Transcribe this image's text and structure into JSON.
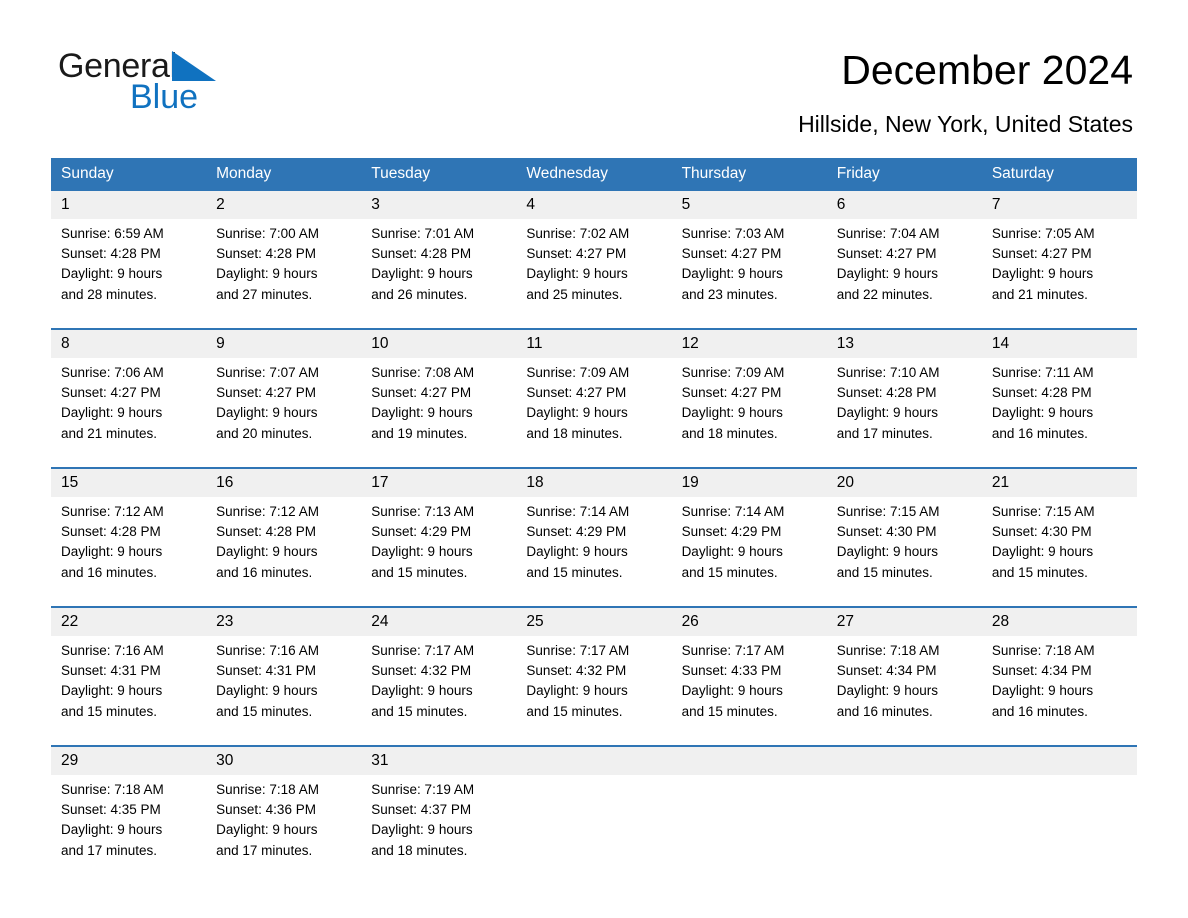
{
  "logo": {
    "word1": "General",
    "word2": "Blue",
    "triangle_color": "#1072c0"
  },
  "header": {
    "title": "December 2024",
    "subtitle": "Hillside, New York, United States"
  },
  "theme": {
    "header_blue": "#2f75b5",
    "daynum_band": "#f0f0f0",
    "text": "#000000"
  },
  "calendar": {
    "weekday_headers": [
      "Sunday",
      "Monday",
      "Tuesday",
      "Wednesday",
      "Thursday",
      "Friday",
      "Saturday"
    ],
    "weeks": [
      {
        "days": [
          {
            "num": "1",
            "l1": "Sunrise: 6:59 AM",
            "l2": "Sunset: 4:28 PM",
            "l3": "Daylight: 9 hours",
            "l4": "and 28 minutes."
          },
          {
            "num": "2",
            "l1": "Sunrise: 7:00 AM",
            "l2": "Sunset: 4:28 PM",
            "l3": "Daylight: 9 hours",
            "l4": "and 27 minutes."
          },
          {
            "num": "3",
            "l1": "Sunrise: 7:01 AM",
            "l2": "Sunset: 4:28 PM",
            "l3": "Daylight: 9 hours",
            "l4": "and 26 minutes."
          },
          {
            "num": "4",
            "l1": "Sunrise: 7:02 AM",
            "l2": "Sunset: 4:27 PM",
            "l3": "Daylight: 9 hours",
            "l4": "and 25 minutes."
          },
          {
            "num": "5",
            "l1": "Sunrise: 7:03 AM",
            "l2": "Sunset: 4:27 PM",
            "l3": "Daylight: 9 hours",
            "l4": "and 23 minutes."
          },
          {
            "num": "6",
            "l1": "Sunrise: 7:04 AM",
            "l2": "Sunset: 4:27 PM",
            "l3": "Daylight: 9 hours",
            "l4": "and 22 minutes."
          },
          {
            "num": "7",
            "l1": "Sunrise: 7:05 AM",
            "l2": "Sunset: 4:27 PM",
            "l3": "Daylight: 9 hours",
            "l4": "and 21 minutes."
          }
        ]
      },
      {
        "days": [
          {
            "num": "8",
            "l1": "Sunrise: 7:06 AM",
            "l2": "Sunset: 4:27 PM",
            "l3": "Daylight: 9 hours",
            "l4": "and 21 minutes."
          },
          {
            "num": "9",
            "l1": "Sunrise: 7:07 AM",
            "l2": "Sunset: 4:27 PM",
            "l3": "Daylight: 9 hours",
            "l4": "and 20 minutes."
          },
          {
            "num": "10",
            "l1": "Sunrise: 7:08 AM",
            "l2": "Sunset: 4:27 PM",
            "l3": "Daylight: 9 hours",
            "l4": "and 19 minutes."
          },
          {
            "num": "11",
            "l1": "Sunrise: 7:09 AM",
            "l2": "Sunset: 4:27 PM",
            "l3": "Daylight: 9 hours",
            "l4": "and 18 minutes."
          },
          {
            "num": "12",
            "l1": "Sunrise: 7:09 AM",
            "l2": "Sunset: 4:27 PM",
            "l3": "Daylight: 9 hours",
            "l4": "and 18 minutes."
          },
          {
            "num": "13",
            "l1": "Sunrise: 7:10 AM",
            "l2": "Sunset: 4:28 PM",
            "l3": "Daylight: 9 hours",
            "l4": "and 17 minutes."
          },
          {
            "num": "14",
            "l1": "Sunrise: 7:11 AM",
            "l2": "Sunset: 4:28 PM",
            "l3": "Daylight: 9 hours",
            "l4": "and 16 minutes."
          }
        ]
      },
      {
        "days": [
          {
            "num": "15",
            "l1": "Sunrise: 7:12 AM",
            "l2": "Sunset: 4:28 PM",
            "l3": "Daylight: 9 hours",
            "l4": "and 16 minutes."
          },
          {
            "num": "16",
            "l1": "Sunrise: 7:12 AM",
            "l2": "Sunset: 4:28 PM",
            "l3": "Daylight: 9 hours",
            "l4": "and 16 minutes."
          },
          {
            "num": "17",
            "l1": "Sunrise: 7:13 AM",
            "l2": "Sunset: 4:29 PM",
            "l3": "Daylight: 9 hours",
            "l4": "and 15 minutes."
          },
          {
            "num": "18",
            "l1": "Sunrise: 7:14 AM",
            "l2": "Sunset: 4:29 PM",
            "l3": "Daylight: 9 hours",
            "l4": "and 15 minutes."
          },
          {
            "num": "19",
            "l1": "Sunrise: 7:14 AM",
            "l2": "Sunset: 4:29 PM",
            "l3": "Daylight: 9 hours",
            "l4": "and 15 minutes."
          },
          {
            "num": "20",
            "l1": "Sunrise: 7:15 AM",
            "l2": "Sunset: 4:30 PM",
            "l3": "Daylight: 9 hours",
            "l4": "and 15 minutes."
          },
          {
            "num": "21",
            "l1": "Sunrise: 7:15 AM",
            "l2": "Sunset: 4:30 PM",
            "l3": "Daylight: 9 hours",
            "l4": "and 15 minutes."
          }
        ]
      },
      {
        "days": [
          {
            "num": "22",
            "l1": "Sunrise: 7:16 AM",
            "l2": "Sunset: 4:31 PM",
            "l3": "Daylight: 9 hours",
            "l4": "and 15 minutes."
          },
          {
            "num": "23",
            "l1": "Sunrise: 7:16 AM",
            "l2": "Sunset: 4:31 PM",
            "l3": "Daylight: 9 hours",
            "l4": "and 15 minutes."
          },
          {
            "num": "24",
            "l1": "Sunrise: 7:17 AM",
            "l2": "Sunset: 4:32 PM",
            "l3": "Daylight: 9 hours",
            "l4": "and 15 minutes."
          },
          {
            "num": "25",
            "l1": "Sunrise: 7:17 AM",
            "l2": "Sunset: 4:32 PM",
            "l3": "Daylight: 9 hours",
            "l4": "and 15 minutes."
          },
          {
            "num": "26",
            "l1": "Sunrise: 7:17 AM",
            "l2": "Sunset: 4:33 PM",
            "l3": "Daylight: 9 hours",
            "l4": "and 15 minutes."
          },
          {
            "num": "27",
            "l1": "Sunrise: 7:18 AM",
            "l2": "Sunset: 4:34 PM",
            "l3": "Daylight: 9 hours",
            "l4": "and 16 minutes."
          },
          {
            "num": "28",
            "l1": "Sunrise: 7:18 AM",
            "l2": "Sunset: 4:34 PM",
            "l3": "Daylight: 9 hours",
            "l4": "and 16 minutes."
          }
        ]
      },
      {
        "days": [
          {
            "num": "29",
            "l1": "Sunrise: 7:18 AM",
            "l2": "Sunset: 4:35 PM",
            "l3": "Daylight: 9 hours",
            "l4": "and 17 minutes."
          },
          {
            "num": "30",
            "l1": "Sunrise: 7:18 AM",
            "l2": "Sunset: 4:36 PM",
            "l3": "Daylight: 9 hours",
            "l4": "and 17 minutes."
          },
          {
            "num": "31",
            "l1": "Sunrise: 7:19 AM",
            "l2": "Sunset: 4:37 PM",
            "l3": "Daylight: 9 hours",
            "l4": "and 18 minutes."
          },
          {
            "num": "",
            "l1": "",
            "l2": "",
            "l3": "",
            "l4": ""
          },
          {
            "num": "",
            "l1": "",
            "l2": "",
            "l3": "",
            "l4": ""
          },
          {
            "num": "",
            "l1": "",
            "l2": "",
            "l3": "",
            "l4": ""
          },
          {
            "num": "",
            "l1": "",
            "l2": "",
            "l3": "",
            "l4": ""
          }
        ]
      }
    ]
  }
}
